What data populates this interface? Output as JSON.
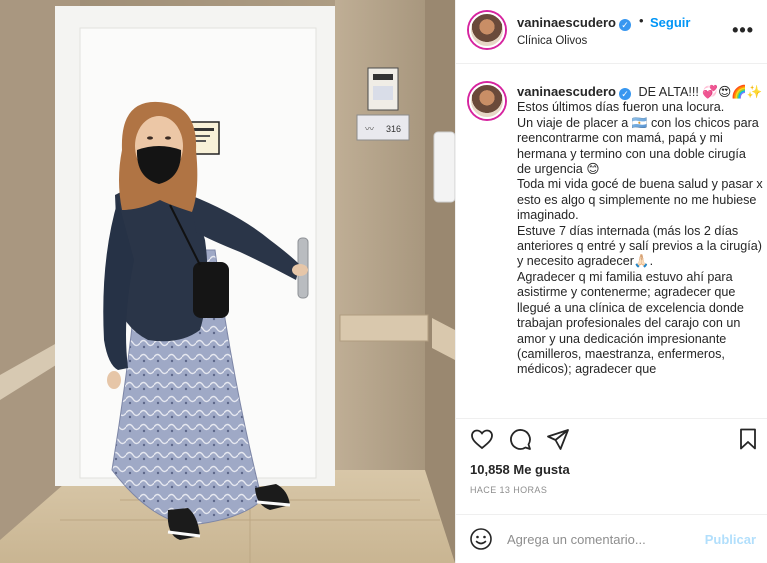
{
  "post": {
    "username": "vaninaescudero",
    "follow_label": "Seguir",
    "location": "Clínica Olivos",
    "photo": {
      "room_number": "316",
      "description_alt": ""
    }
  },
  "caption": {
    "username": "vaninaescudero",
    "lines": [
      "DE ALTA!!! 💞😍🌈✨",
      "Estos últimos días fueron una locura.",
      "Un viaje de placer a 🇦🇷 con los chicos para reencontrarme con mamá, papá y mi hermana y termino con una doble cirugía de urgencia 😊",
      "Toda mi vida gocé de buena salud y pasar x esto es algo q simplemente no me hubiese imaginado.",
      "Estuve 7 días internada (más los 2 días anteriores q entré y salí previos a la cirugía) y necesito agradecer🙏🏻.",
      "Agradecer q mi familia estuvo ahí para asistirme y contenerme; agradecer que llegué a una clínica de excelencia donde trabajan profesionales del carajo con un amor y una dedicación impresionante (camilleros, maestranza, enfermeros, médicos); agradecer que"
    ]
  },
  "stats": {
    "likes_text": "10,858 Me gusta",
    "time_ago": "HACE 13 HORAS"
  },
  "comment": {
    "placeholder": "Agrega un comentario...",
    "publish_label": "Publicar"
  },
  "icons": {
    "like": "heart-icon",
    "comment": "comment-icon",
    "share": "paper-plane-icon",
    "save": "bookmark-icon",
    "more": "more-horizontal-icon",
    "emoji": "emoji-icon",
    "verified": "verified-badge-icon"
  },
  "colors": {
    "link_blue": "#0095f6",
    "verified_blue": "#3897f0",
    "muted_gray": "#8e8e8e",
    "publish_disabled": "#b2dffc"
  }
}
